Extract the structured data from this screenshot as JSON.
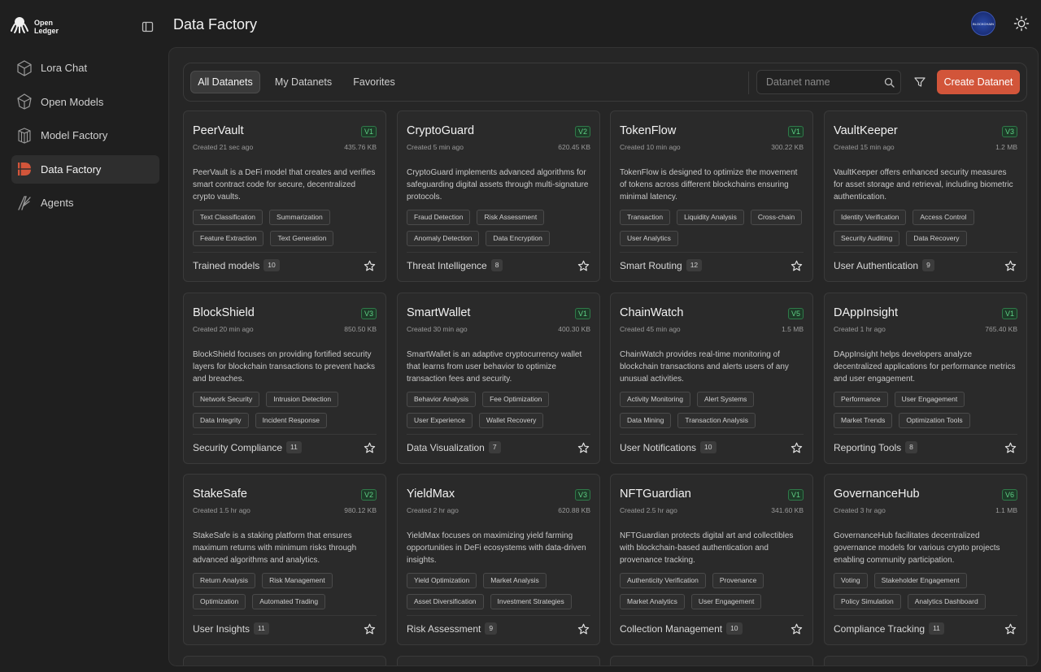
{
  "brand": {
    "line1": "Open",
    "line2": "Ledger"
  },
  "sidebar": {
    "items": [
      {
        "label": "Lora Chat",
        "icon": "cube-chat-icon",
        "active": false
      },
      {
        "label": "Open Models",
        "icon": "hex-models-icon",
        "active": false
      },
      {
        "label": "Model Factory",
        "icon": "model-factory-icon",
        "active": false
      },
      {
        "label": "Data Factory",
        "icon": "data-factory-icon",
        "active": true
      },
      {
        "label": "Agents",
        "icon": "agents-icon",
        "active": false
      }
    ]
  },
  "header": {
    "title": "Data Factory",
    "avatar_text": "BLOCKCHAIN"
  },
  "toolbar": {
    "tabs": [
      "All Datanets",
      "My Datanets",
      "Favorites"
    ],
    "active_tab": 0,
    "search_placeholder": "Datanet name",
    "create_label": "Create Datanet"
  },
  "colors": {
    "accent": "#d2553a",
    "version_green": "#5fcf85"
  },
  "cards": [
    {
      "name": "PeerVault",
      "version": "V1",
      "created": "Created 21 sec ago",
      "size": "435.76 KB",
      "description": "PeerVault is a DeFi model that creates and verifies smart contract code for secure, decentralized crypto vaults.",
      "tags": [
        "Text Classification",
        "Summarization",
        "Feature Extraction",
        "Text Generation"
      ],
      "footer_label": "Trained models",
      "footer_count": "10"
    },
    {
      "name": "CryptoGuard",
      "version": "V2",
      "created": "Created 5 min ago",
      "size": "620.45 KB",
      "description": "CryptoGuard implements advanced algorithms for safeguarding digital assets through multi-signature protocols.",
      "tags": [
        "Fraud Detection",
        "Risk Assessment",
        "Anomaly Detection",
        "Data Encryption"
      ],
      "footer_label": "Threat Intelligence",
      "footer_count": "8"
    },
    {
      "name": "TokenFlow",
      "version": "V1",
      "created": "Created 10 min ago",
      "size": "300.22 KB",
      "description": "TokenFlow is designed to optimize the movement of tokens across different blockchains ensuring minimal latency.",
      "tags": [
        "Transaction",
        "Liquidity Analysis",
        "Cross-chain",
        "User Analytics"
      ],
      "footer_label": "Smart Routing",
      "footer_count": "12"
    },
    {
      "name": "VaultKeeper",
      "version": "V3",
      "created": "Created 15 min ago",
      "size": "1.2 MB",
      "description": "VaultKeeper offers enhanced security measures for asset storage and retrieval, including biometric authentication.",
      "tags": [
        "Identity Verification",
        "Access Control",
        "Security Auditing",
        "Data Recovery"
      ],
      "footer_label": "User Authentication",
      "footer_count": "9"
    },
    {
      "name": "BlockShield",
      "version": "V3",
      "created": "Created 20 min ago",
      "size": "850.50 KB",
      "description": "BlockShield focuses on providing fortified security layers for blockchain transactions to prevent hacks and breaches.",
      "tags": [
        "Network Security",
        "Intrusion Detection",
        "Data Integrity",
        "Incident Response"
      ],
      "footer_label": "Security Compliance",
      "footer_count": "11"
    },
    {
      "name": "SmartWallet",
      "version": "V1",
      "created": "Created 30 min ago",
      "size": "400.30 KB",
      "description": "SmartWallet is an adaptive cryptocurrency wallet that learns from user behavior to optimize transaction fees and security.",
      "tags": [
        "Behavior Analysis",
        "Fee Optimization",
        "User Experience",
        "Wallet Recovery"
      ],
      "footer_label": "Data Visualization",
      "footer_count": "7"
    },
    {
      "name": "ChainWatch",
      "version": "V5",
      "created": "Created 45 min ago",
      "size": "1.5 MB",
      "description": "ChainWatch provides real-time monitoring of blockchain transactions and alerts users of any unusual activities.",
      "tags": [
        "Activity Monitoring",
        "Alert Systems",
        "Data Mining",
        "Transaction Analysis"
      ],
      "footer_label": "User Notifications",
      "footer_count": "10"
    },
    {
      "name": "DAppInsight",
      "version": "V1",
      "created": "Created 1 hr ago",
      "size": "765.40 KB",
      "description": "DAppInsight helps developers analyze decentralized applications for performance metrics and user engagement.",
      "tags": [
        "Performance",
        "User Engagement",
        "Market Trends",
        "Optimization Tools"
      ],
      "footer_label": "Reporting Tools",
      "footer_count": "8"
    },
    {
      "name": "StakeSafe",
      "version": "V2",
      "created": "Created 1.5 hr ago",
      "size": "980.12 KB",
      "description": "StakeSafe is a staking platform that ensures maximum returns with minimum risks through advanced algorithms and analytics.",
      "tags": [
        "Return Analysis",
        "Risk Management",
        "Optimization",
        "Automated Trading"
      ],
      "footer_label": "User Insights",
      "footer_count": "11"
    },
    {
      "name": "YieldMax",
      "version": "V3",
      "created": "Created 2 hr ago",
      "size": "620.88 KB",
      "description": "YieldMax focuses on maximizing yield farming opportunities in DeFi ecosystems with data-driven insights.",
      "tags": [
        "Yield Optimization",
        "Market Analysis",
        "Asset Diversification",
        "Investment Strategies"
      ],
      "footer_label": "Risk Assessment",
      "footer_count": "9"
    },
    {
      "name": "NFTGuardian",
      "version": "V1",
      "created": "Created 2.5 hr ago",
      "size": "341.60 KB",
      "description": "NFTGuardian protects digital art and collectibles with blockchain-based authentication and provenance tracking.",
      "tags": [
        "Authenticity Verification",
        "Provenance",
        "Market Analytics",
        "User Engagement"
      ],
      "footer_label": "Collection Management",
      "footer_count": "10"
    },
    {
      "name": "GovernanceHub",
      "version": "V6",
      "created": "Created 3 hr ago",
      "size": "1.1 MB",
      "description": "GovernanceHub facilitates decentralized governance models for various crypto projects enabling community participation.",
      "tags": [
        "Voting",
        "Stakeholder Engagement",
        "Policy Simulation",
        "Analytics Dashboard"
      ],
      "footer_label": "Compliance Tracking",
      "footer_count": "11"
    }
  ]
}
